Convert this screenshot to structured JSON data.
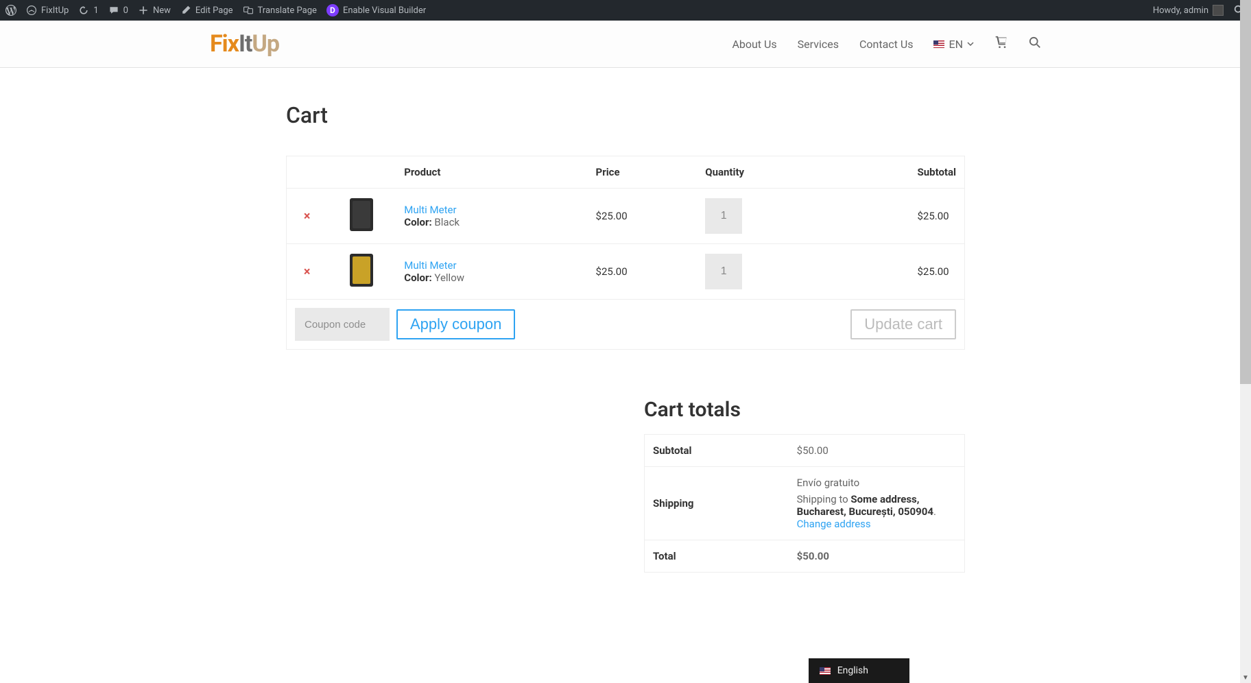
{
  "adminbar": {
    "site": "FixItUp",
    "updates": "1",
    "comments": "0",
    "new": "New",
    "edit_page": "Edit Page",
    "translate_page": "Translate Page",
    "enable_vb": "Enable Visual Builder",
    "howdy": "Howdy, admin"
  },
  "header": {
    "nav": {
      "about": "About Us",
      "services": "Services",
      "contact": "Contact Us"
    },
    "lang_code": "EN"
  },
  "cart": {
    "title": "Cart",
    "headers": {
      "product": "Product",
      "price": "Price",
      "qty": "Quantity",
      "subtotal": "Subtotal"
    },
    "items": [
      {
        "name": "Multi Meter",
        "attr_label": "Color:",
        "attr_value": "Black",
        "price": "$25.00",
        "qty": "1",
        "subtotal": "$25.00"
      },
      {
        "name": "Multi Meter",
        "attr_label": "Color:",
        "attr_value": "Yellow",
        "price": "$25.00",
        "qty": "1",
        "subtotal": "$25.00"
      }
    ],
    "coupon_placeholder": "Coupon code",
    "apply_coupon": "Apply coupon",
    "update_cart": "Update cart"
  },
  "totals": {
    "title": "Cart totals",
    "subtotal_label": "Subtotal",
    "subtotal": "$50.00",
    "shipping_label": "Shipping",
    "shipping_method": "Envío gratuito",
    "shipping_to_prefix": "Shipping to ",
    "shipping_address": "Some address, Bucharest, București, 050904",
    "change_address": "Change address",
    "total_label": "Total",
    "total": "$50.00"
  },
  "lang_switcher": {
    "label": "English"
  }
}
